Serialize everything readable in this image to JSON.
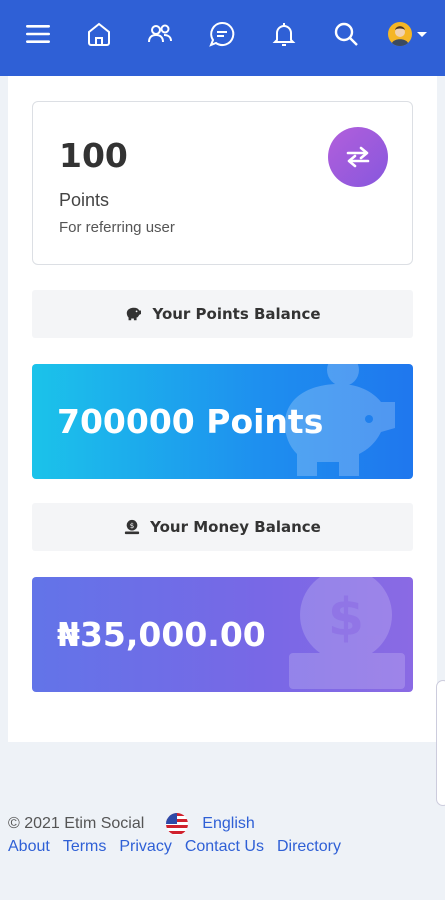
{
  "topbar": {
    "icons": [
      "menu-icon",
      "home-icon",
      "users-icon",
      "chat-icon",
      "bell-icon",
      "search-icon",
      "avatar",
      "chevron-down-icon"
    ],
    "color": "#2f60d6"
  },
  "points_card": {
    "value": "100",
    "label": "Points",
    "sub": "For referring user",
    "icon": "transfer-icon"
  },
  "points_section": {
    "label": "Your Points Balance",
    "icon": "piggy-bank-icon"
  },
  "points_balance": {
    "value": "700000 Points"
  },
  "money_section": {
    "label": "Your Money Balance",
    "icon": "money-bag-icon"
  },
  "money_balance": {
    "value": "₦35,000.00"
  },
  "footer": {
    "copyright": "© 2021 Etim Social",
    "language": "English",
    "links": [
      "About",
      "Terms",
      "Privacy",
      "Contact Us",
      "Directory"
    ]
  }
}
